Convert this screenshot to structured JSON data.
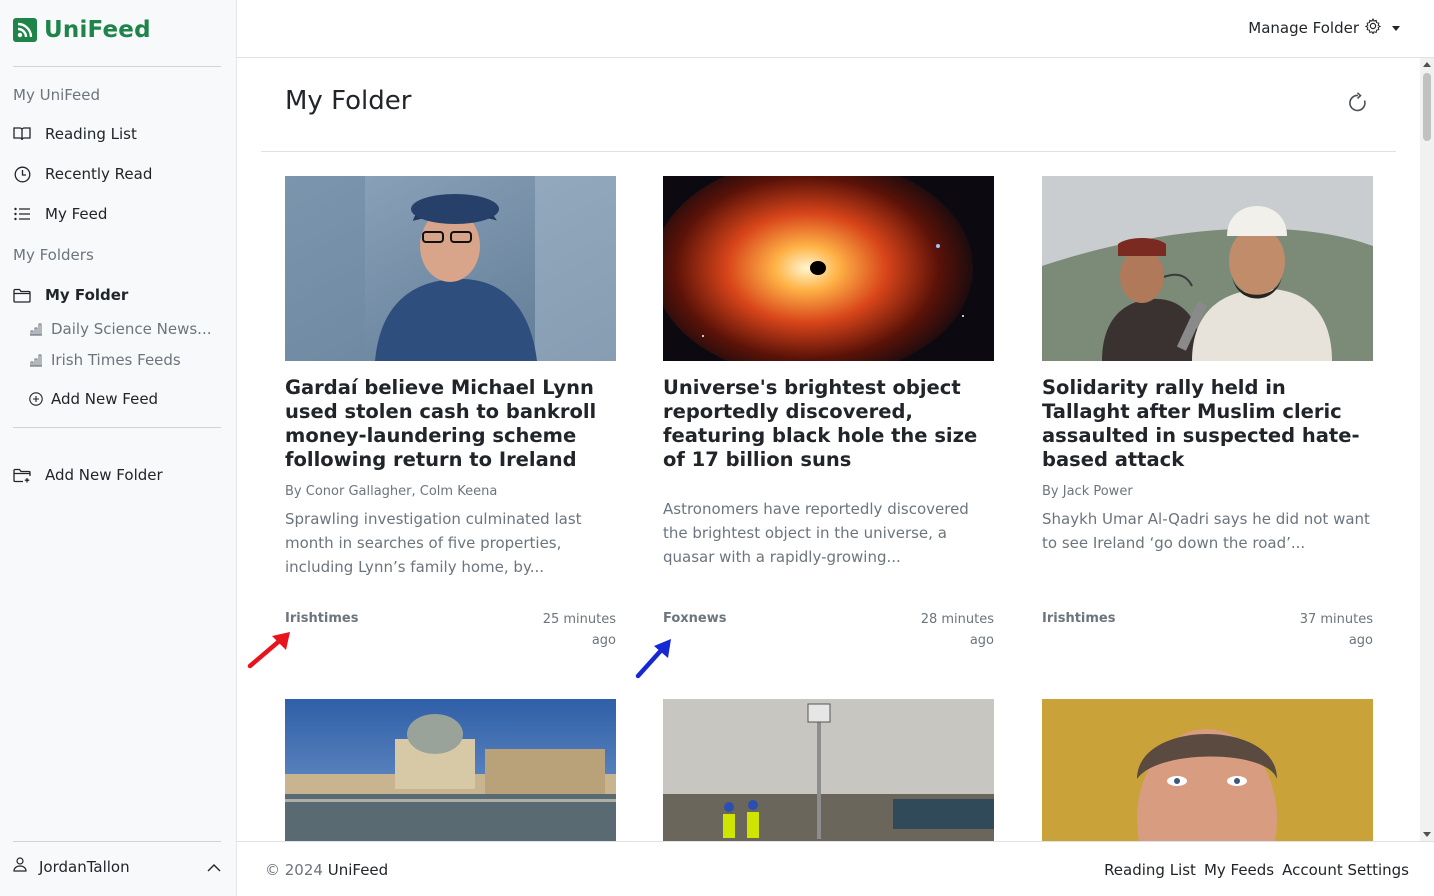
{
  "app": {
    "name": "UniFeed"
  },
  "sidebar": {
    "section_main": "My UniFeed",
    "main_items": [
      {
        "label": "Reading List",
        "icon": "book-icon"
      },
      {
        "label": "Recently Read",
        "icon": "clock-icon"
      },
      {
        "label": "My Feed",
        "icon": "list-icon"
      }
    ],
    "section_folders": "My Folders",
    "folder": {
      "label": "My Folder",
      "icon": "folder-icon"
    },
    "feeds": [
      {
        "label": "Daily Science News...",
        "icon": "bar-chart-icon"
      },
      {
        "label": "Irish Times Feeds",
        "icon": "bar-chart-icon"
      }
    ],
    "add_feed": "Add New Feed",
    "add_folder": "Add New Folder",
    "user": "JordanTallon"
  },
  "topbar": {
    "manage_label": "Manage Folder"
  },
  "main": {
    "title": "My Folder",
    "cards": [
      {
        "title": "Gardaí believe Michael Lynn used stolen cash to bankroll money-laundering scheme following return to Ireland",
        "author": "By Conor Gallagher, Colm Keena",
        "description": "Sprawling investigation culminated last month in searches of five properties, including Lynn’s family home, by...",
        "source": "Irishtimes",
        "time_line1": "25 minutes",
        "time_line2": "ago"
      },
      {
        "title": "Universe's brightest object reportedly discovered, featuring black hole the size of 17 billion suns",
        "author": "",
        "description": "Astronomers have reportedly discovered the brightest object in the universe, a quasar with a rapidly-growing...",
        "source": "Foxnews",
        "time_line1": "28 minutes",
        "time_line2": "ago"
      },
      {
        "title": "Solidarity rally held in Tallaght after Muslim cleric assaulted in suspected hate-based attack",
        "author": "By Jack Power",
        "description": "Shaykh Umar Al-Qadri says he did not want to see Ireland ‘go down the road’...",
        "source": "Irishtimes",
        "time_line1": "37 minutes",
        "time_line2": "ago"
      }
    ]
  },
  "footer": {
    "copyright": "© 2024",
    "brand": "UniFeed",
    "links": [
      "Reading List",
      "My Feeds",
      "Account Settings"
    ]
  },
  "colors": {
    "brand": "#1e8449",
    "annotation_red": "#e8141c",
    "annotation_blue": "#1428d4"
  }
}
